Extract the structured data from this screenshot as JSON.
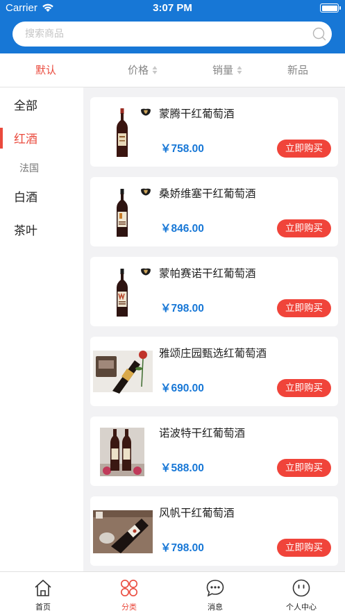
{
  "status": {
    "carrier": "Carrier",
    "time": "3:07 PM"
  },
  "search": {
    "placeholder": "搜索商品"
  },
  "sort": {
    "default_label": "默认",
    "price_label": "价格",
    "sales_label": "销量",
    "new_label": "新品"
  },
  "sidebar": {
    "items": [
      {
        "label": "全部"
      },
      {
        "label": "红酒",
        "active": true
      },
      {
        "label": "法国"
      },
      {
        "label": "白酒"
      },
      {
        "label": "茶叶"
      }
    ]
  },
  "products": [
    {
      "name": "蒙腾干红葡萄酒",
      "price": "￥758.00",
      "buy": "立即购买"
    },
    {
      "name": "桑娇维塞干红葡萄酒",
      "price": "￥846.00",
      "buy": "立即购买"
    },
    {
      "name": "蒙帕赛诺干红葡萄酒",
      "price": "￥798.00",
      "buy": "立即购买"
    },
    {
      "name": "雅颂庄园甄选红葡萄酒",
      "price": "￥690.00",
      "buy": "立即购买"
    },
    {
      "name": "诺波特干红葡萄酒",
      "price": "￥588.00",
      "buy": "立即购买"
    },
    {
      "name": "风帆干红葡萄酒",
      "price": "￥798.00",
      "buy": "立即购买"
    }
  ],
  "tabbar": {
    "home": "首页",
    "category": "分类",
    "messages": "消息",
    "profile": "个人中心"
  },
  "colors": {
    "header": "#1777d6",
    "accent": "#ea4a3d",
    "buy_button": "#f0443a",
    "price": "#1777d6"
  }
}
